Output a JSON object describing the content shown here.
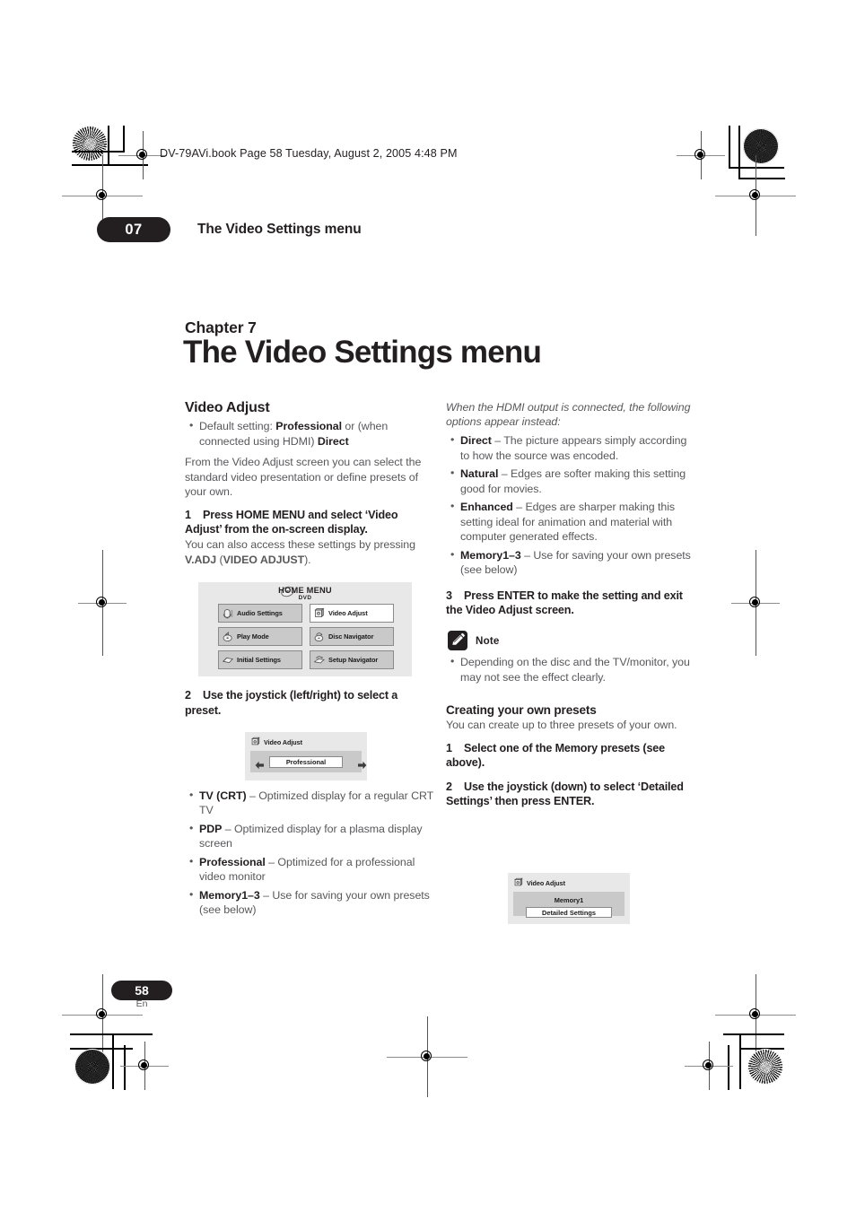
{
  "header": {
    "book_line": "DV-79AVi.book   Page 58   Tuesday, August 2, 2005   4:48 PM",
    "chapter_number": "07",
    "running_title": "The Video Settings menu"
  },
  "chapter": {
    "label": "Chapter 7",
    "title": "The Video Settings menu"
  },
  "left_column": {
    "section_title": "Video Adjust",
    "default_setting_bullet": "Default setting: <b>Professional</b> or (when connected using HDMI) <b>Direct</b>",
    "intro": "From the Video Adjust screen you can select the standard video presentation or define presets of your own.",
    "step1_num": "1",
    "step1_text": "Press HOME MENU and select ‘Video Adjust’ from the on-screen display.",
    "step1_body": "You can also access these settings by pressing <b>V.ADJ</b> (<b>VIDEO ADJUST</b>).",
    "step2_num": "2",
    "step2_text": "Use the joystick (left/right) to select a preset.",
    "presets": [
      "<b>TV (CRT)</b> – Optimized display for a regular CRT TV",
      "<b>PDP</b> – Optimized display for a plasma display screen",
      "<b>Professional</b> – Optimized for a professional video monitor",
      "<b>Memory1–3</b> – Use for saving your own presets (see below)"
    ]
  },
  "right_column": {
    "hdmi_note": "When the HDMI output is connected, the following options appear instead:",
    "hdmi_options": [
      "<b>Direct</b> – The picture appears simply according to how the source was encoded.",
      "<b>Natural</b> – Edges are softer making this setting good for movies.",
      "<b>Enhanced</b> – Edges are sharper making this setting ideal for animation and material with computer generated effects.",
      "<b>Memory1–3</b> – Use for saving your own presets (see below)"
    ],
    "step3_num": "3",
    "step3_text": "Press ENTER to make the setting and exit the Video Adjust screen.",
    "note_label": "Note",
    "note_items": [
      "Depending on the disc and the TV/monitor, you may not see the effect clearly."
    ],
    "subsection_title": "Creating your own presets",
    "subsection_body": "You can create up to three presets of your own.",
    "cstep1_num": "1",
    "cstep1_text": "Select one of the Memory presets (see above).",
    "cstep2_num": "2",
    "cstep2_text": "Use the joystick (down) to select ‘Detailed Settings’ then press ENTER."
  },
  "osd_home_menu": {
    "title": "HOME MENU",
    "subtitle": "DVD",
    "buttons": [
      {
        "label": "Audio Settings",
        "icon": "audio-settings-icon",
        "selected": false
      },
      {
        "label": "Video Adjust",
        "icon": "video-adjust-icon",
        "selected": true
      },
      {
        "label": "Play Mode",
        "icon": "play-mode-icon",
        "selected": false
      },
      {
        "label": "Disc Navigator",
        "icon": "disc-navigator-icon",
        "selected": false
      },
      {
        "label": "Initial Settings",
        "icon": "initial-settings-icon",
        "selected": false
      },
      {
        "label": "Setup Navigator",
        "icon": "setup-navigator-icon",
        "selected": false
      }
    ]
  },
  "osd_video_adjust_preset": {
    "title": "Video Adjust",
    "value": "Professional"
  },
  "osd_video_adjust_memory": {
    "title": "Video Adjust",
    "memory_label": "Memory1",
    "button_label": "Detailed Settings"
  },
  "footer": {
    "page_number": "58",
    "language": "En"
  },
  "colors": {
    "ink": "#231f20",
    "body_gray": "#58585b",
    "osd_bg": "#e8e8e8",
    "osd_button": "#c9c9c9"
  }
}
